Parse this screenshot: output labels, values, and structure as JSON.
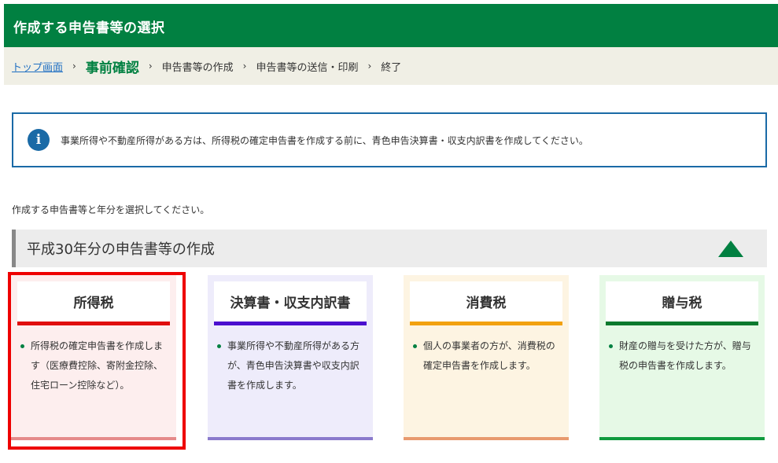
{
  "header": {
    "title": "作成する申告書等の選択"
  },
  "breadcrumb": {
    "top_link": "トップ画面",
    "separator": "›",
    "current": "事前確認",
    "steps": [
      "申告書等の作成",
      "申告書等の送信・印刷",
      "終了"
    ]
  },
  "notice": {
    "icon": "info-icon",
    "icon_glyph": "i",
    "text": "事業所得や不動産所得がある方は、所得税の確定申告書を作成する前に、青色申告決算書・収支内訳書を作成してください。"
  },
  "instruction": "作成する申告書等と年分を選択してください。",
  "section": {
    "title": "平成30年分の申告書等の作成",
    "toggle_icon": "collapse-triangle-icon"
  },
  "cards": [
    {
      "title": "所得税",
      "description": "所得税の確定申告書を作成します（医療費控除、寄附金控除、住宅ローン控除など）。",
      "accent_color": "#e00e0e",
      "selected": true
    },
    {
      "title": "決算書・収支内訳書",
      "description": "事業所得や不動産所得がある方が、青色申告決算書や収支内訳書を作成します。",
      "accent_color": "#4a0fcf",
      "selected": false
    },
    {
      "title": "消費税",
      "description": "個人の事業者の方が、消費税の確定申告書を作成します。",
      "accent_color": "#f2a10f",
      "selected": false
    },
    {
      "title": "贈与税",
      "description": "財産の贈与を受けた方が、贈与税の申告書を作成します。",
      "accent_color": "#0a7a2e",
      "selected": false
    }
  ],
  "colors": {
    "brand_green": "#018041",
    "breadcrumb_bg": "#f0efe5",
    "info_blue": "#1a6aa6",
    "selection_red": "#ee0000"
  }
}
